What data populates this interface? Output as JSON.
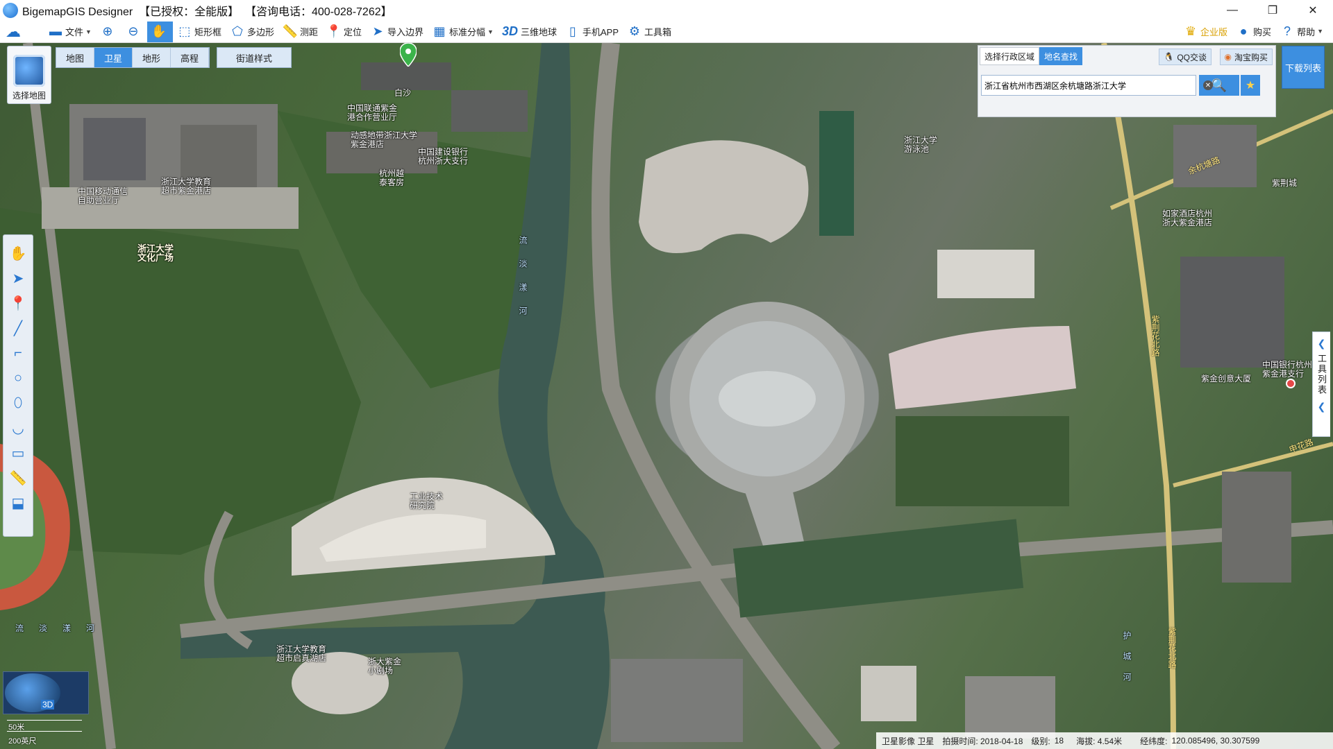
{
  "app": {
    "title": "BigemapGIS Designer  【已授权：全能版】  【咨询电话：400-028-7262】"
  },
  "window_controls": {
    "minimize": "—",
    "restore": "❐",
    "close": "✕"
  },
  "toolbar": {
    "items": [
      {
        "label": "文件",
        "icon": "folder-icon",
        "caret": true
      },
      {
        "label": "",
        "icon": "zoom-in-icon"
      },
      {
        "label": "",
        "icon": "zoom-out-icon"
      },
      {
        "label": "",
        "icon": "hand-pan-icon",
        "active": true
      },
      {
        "label": "矩形框",
        "icon": "rectangle-select-icon"
      },
      {
        "label": "多边形",
        "icon": "polygon-select-icon"
      },
      {
        "label": "测距",
        "icon": "ruler-icon"
      },
      {
        "label": "定位",
        "icon": "location-pin-icon"
      },
      {
        "label": "导入边界",
        "icon": "import-boundary-icon"
      },
      {
        "label": "标准分幅",
        "icon": "grid-icon",
        "caret": true
      },
      {
        "label": "三维地球",
        "icon": "3d-icon"
      },
      {
        "label": "手机APP",
        "icon": "mobile-icon"
      },
      {
        "label": "工具箱",
        "icon": "gear-icon"
      }
    ],
    "right": [
      {
        "label": "企业版",
        "icon": "crown-icon"
      },
      {
        "label": "购买",
        "icon": "buy-icon"
      },
      {
        "label": "帮助",
        "icon": "help-icon",
        "caret": true
      }
    ],
    "threeD_text": "3D"
  },
  "map_controls": {
    "select_map_label": "选择地图",
    "tabs": [
      "地图",
      "卫星",
      "地形",
      "高程"
    ],
    "active_tab": "卫星",
    "street_style_label": "街道样式"
  },
  "search_panel": {
    "tabs": [
      "选择行政区域",
      "地名查找"
    ],
    "active_tab": "地名查找",
    "qq_label": "QQ交谈",
    "taobao_label": "淘宝购买",
    "input_value": "浙江省杭州市西湖区余杭塘路浙江大学",
    "download_list_label": "下载列表"
  },
  "right_panel": {
    "label": "工具列表"
  },
  "map_labels": [
    {
      "text": "白沙"
    },
    {
      "text": "中国联通紫金\n港合作营业厅"
    },
    {
      "text": "动感地带浙江大学\n紫金港店"
    },
    {
      "text": "中国建设银行\n杭州浙大支行"
    },
    {
      "text": "杭州越\n泰客房"
    },
    {
      "text": "浙江大学教育\n超市紫金港店"
    },
    {
      "text": "中国移动通信\n自助营业厅"
    },
    {
      "text": "浙江大学\n文化广场",
      "bold": true
    },
    {
      "text": "浙江大学\n游泳池"
    },
    {
      "text": "如家酒店杭州\n浙大紫金港店"
    },
    {
      "text": "紫荆城"
    },
    {
      "text": "紫金创意大厦"
    },
    {
      "text": "中国银行杭州\n紫金港支行"
    },
    {
      "text": "工业技术\n研究院"
    },
    {
      "text": "浙江大学教育\n超市启真湖店"
    },
    {
      "text": "浙大紫金\n小剧场"
    }
  ],
  "water_labels": [
    {
      "text": "流淡漾河"
    },
    {
      "text": "流淡漾河"
    },
    {
      "text": "护城河"
    }
  ],
  "road_labels": [
    {
      "text": "紫荆花北路"
    },
    {
      "text": "紫荆花北路"
    },
    {
      "text": "余杭塘路"
    },
    {
      "text": "申花路"
    }
  ],
  "overview": {
    "badge": "3D"
  },
  "scale": {
    "metric": "50米",
    "imperial": "200英尺"
  },
  "status": {
    "imagery": "卫星影像 卫星",
    "date_label": "拍摄时间: 2018-04-18",
    "level_label": "级别:",
    "level_value": "18",
    "altitude_label": "海拔: 4.54米",
    "coords_label": "经纬度:",
    "coords_value": "120.085496, 30.307599"
  }
}
